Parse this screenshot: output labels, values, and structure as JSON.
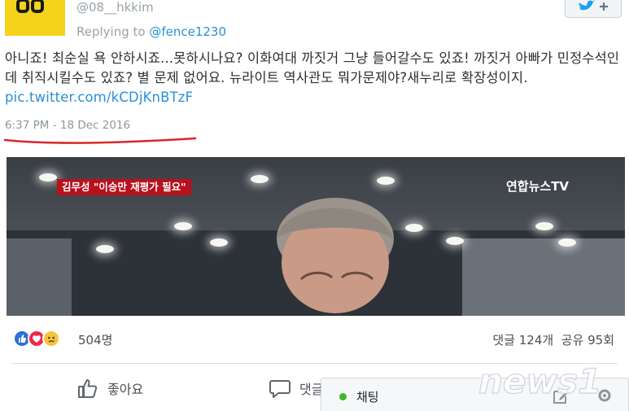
{
  "tweet": {
    "handle": "@08__hkkim",
    "replying_prefix": "Replying to ",
    "replying_to": "@fence1230",
    "body": "아니죠! 최순실 욕 안하시죠...못하시나요? 이화여대 까짓거 그냥 들어갈수도 있죠! 까짓거 아빠가 민정수석인데 취직시킬수도 있죠? 별 문제 없어요. 뉴라이트 역사관도 뭐가문제야?새누리로 확장성이지. ",
    "link": "pic.twitter.com/kCDjKnBTzF",
    "timestamp": "6:37 PM - 18 Dec 2016",
    "avatar_icon": "yellow-logo-avatar",
    "follow_icon": "twitter-bird-follow-icon"
  },
  "video": {
    "caption": "김무성 \"이승만 재평가 필요\"",
    "channel": "연합뉴스TV"
  },
  "facebook": {
    "reaction_count": "504명",
    "comments": "댓글 124개",
    "shares": "공유 95회",
    "like_label": "좋아요",
    "comment_label": "댓글",
    "reaction_icons": [
      "like-icon",
      "love-icon",
      "sad-icon"
    ],
    "colors": {
      "like": "#2f6fd6",
      "love": "#f0284a",
      "sad": "#f7c53a",
      "text": "#4b4f56"
    }
  },
  "chat": {
    "label": "채팅",
    "status_color": "#42b72a"
  },
  "watermark": {
    "text": "news1"
  }
}
